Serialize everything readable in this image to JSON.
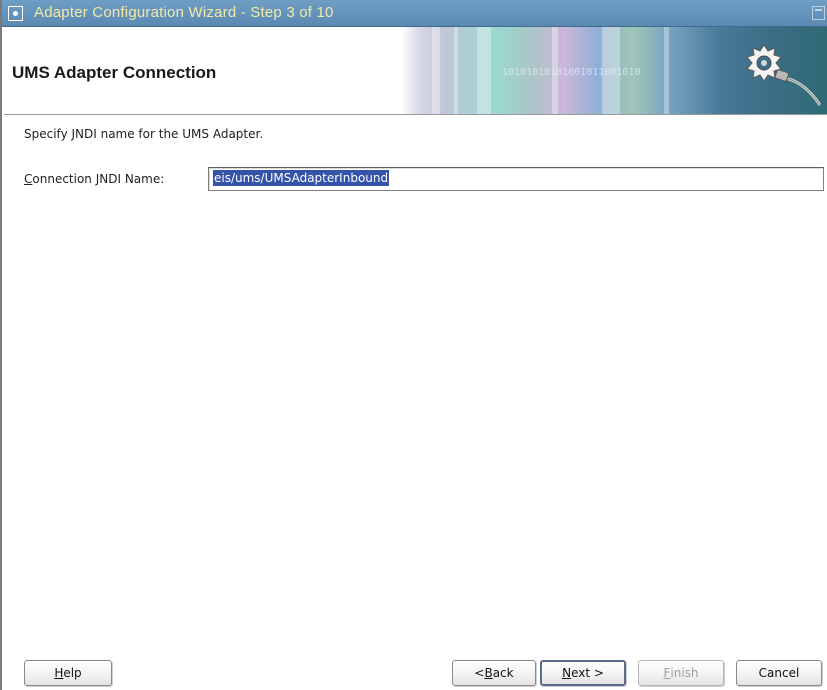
{
  "window": {
    "title": "Adapter Configuration Wizard - Step 3 of 10"
  },
  "header": {
    "page_title": "UMS Adapter Connection",
    "banner_text": "10101010101001011001010"
  },
  "content": {
    "instruction": "Specify JNDI name for the UMS Adapter.",
    "connection_jndi": {
      "label_mnemonic": "C",
      "label_rest": "onnection JNDI Name:",
      "value": "eis/ums/UMSAdapterInbound",
      "selected": true
    }
  },
  "buttons": {
    "help": {
      "mnemonic": "H",
      "rest": "elp",
      "enabled": true
    },
    "back": {
      "prefix": "< ",
      "mnemonic": "B",
      "rest": "ack",
      "enabled": true
    },
    "next": {
      "mnemonic": "N",
      "rest": "ext >",
      "enabled": true,
      "default": true
    },
    "finish": {
      "mnemonic": "F",
      "rest": "inish",
      "enabled": false
    },
    "cancel": {
      "label": "Cancel",
      "enabled": true
    }
  },
  "colors": {
    "titlebar": "#5a8ab2",
    "title_text": "#f4e9a8",
    "selection": "#3354a8"
  },
  "icons": {
    "window_menu": "window-menu-icon",
    "maximize": "maximize-icon",
    "banner_graphic": "gear-plug-icon"
  }
}
